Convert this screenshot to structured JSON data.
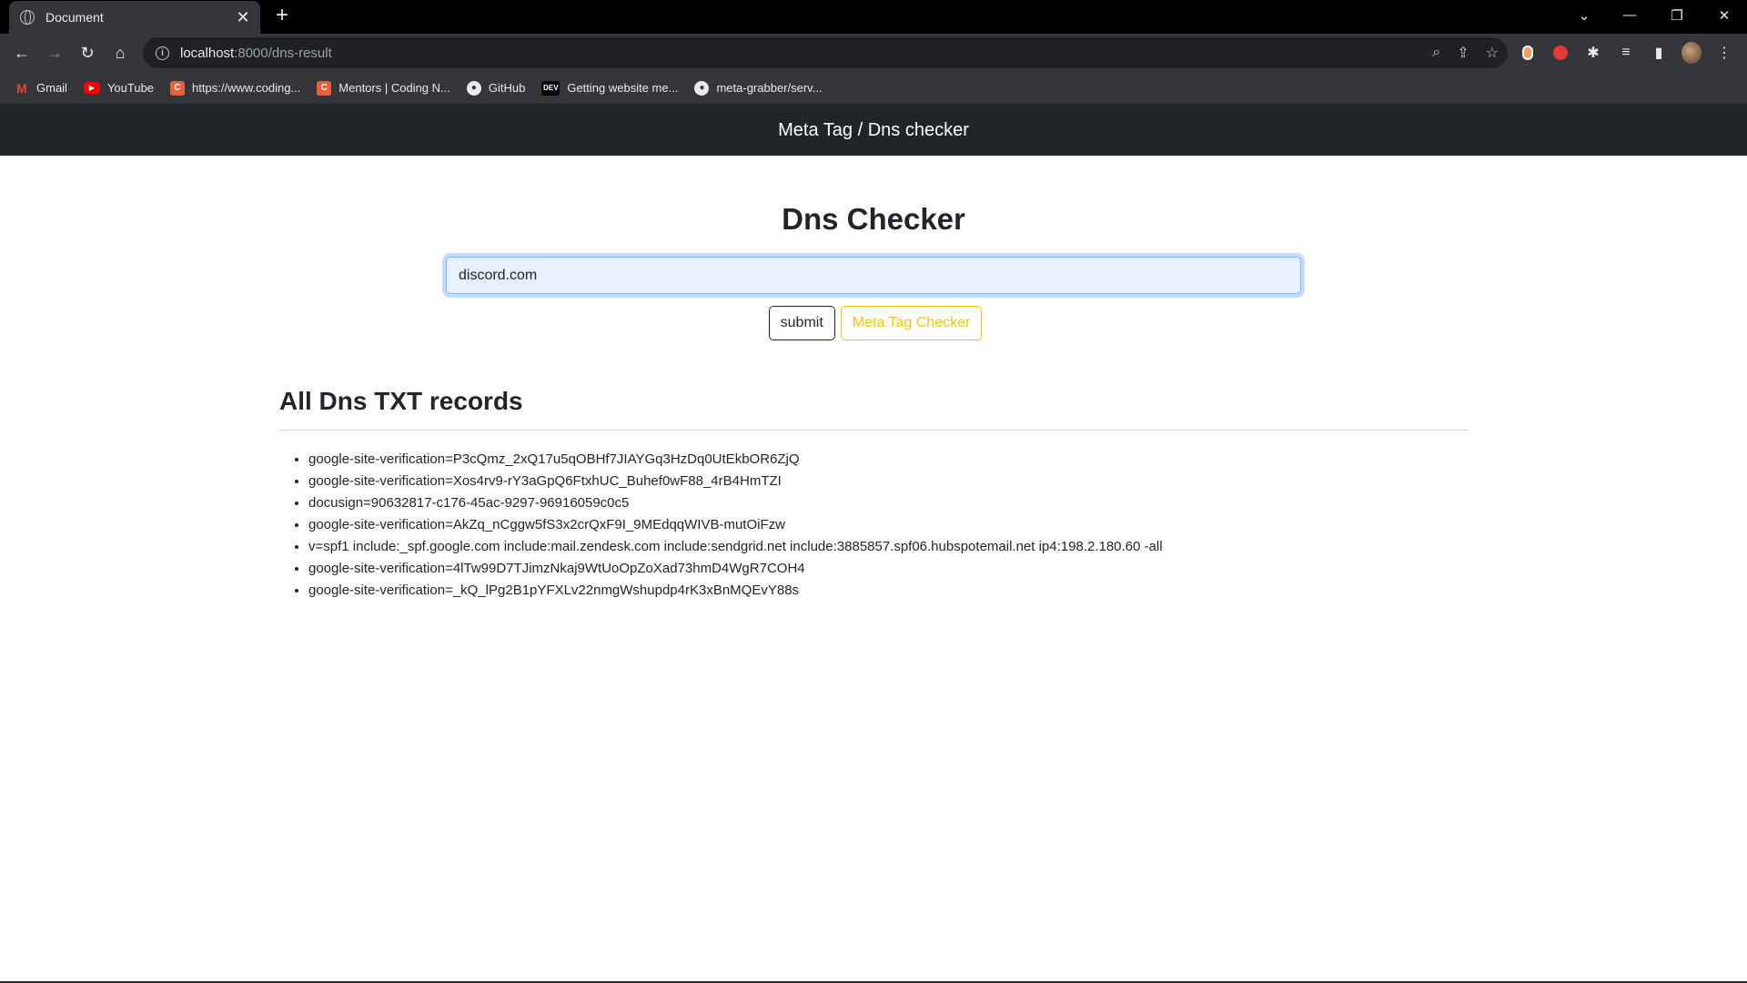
{
  "browser": {
    "tab_title": "Document",
    "tab_close": "✕",
    "new_tab": "+",
    "url_host": "localhost",
    "url_path": ":8000/dns-result",
    "bookmarks": [
      {
        "label": "Gmail",
        "icon": "gmail-icon"
      },
      {
        "label": "YouTube",
        "icon": "youtube-icon"
      },
      {
        "label": "https://www.coding...",
        "icon": "codingninjas-icon"
      },
      {
        "label": "Mentors | Coding N...",
        "icon": "codingninjas-icon"
      },
      {
        "label": "GitHub",
        "icon": "github-icon"
      },
      {
        "label": "Getting website me...",
        "icon": "dev-icon"
      },
      {
        "label": "meta-grabber/serv...",
        "icon": "github-icon"
      }
    ]
  },
  "navbar": {
    "title": "Meta Tag / Dns checker"
  },
  "main": {
    "title": "Dns Checker",
    "input_value": "discord.com",
    "submit_label": "submit",
    "meta_label": "Meta Tag Checker"
  },
  "records": {
    "heading": "All Dns TXT records",
    "items": [
      "google-site-verification=P3cQmz_2xQ17u5qOBHf7JIAYGq3HzDq0UtEkbOR6ZjQ",
      "google-site-verification=Xos4rv9-rY3aGpQ6FtxhUC_Buhef0wF88_4rB4HmTZI",
      "docusign=90632817-c176-45ac-9297-96916059c0c5",
      "google-site-verification=AkZq_nCggw5fS3x2crQxF9I_9MEdqqWIVB-mutOiFzw",
      "v=spf1 include:_spf.google.com include:mail.zendesk.com include:sendgrid.net include:3885857.spf06.hubspotemail.net ip4:198.2.180.60 -all",
      "google-site-verification=4lTw99D7TJimzNkaj9WtUoOpZoXad73hmD4WgR7COH4",
      "google-site-verification=_kQ_lPg2B1pYFXLv22nmgWshupdp4rK3xBnMQEvY88s"
    ]
  },
  "colors": {
    "navbar": "#212529",
    "warning": "#ffc107",
    "focus": "#86b7fe"
  }
}
